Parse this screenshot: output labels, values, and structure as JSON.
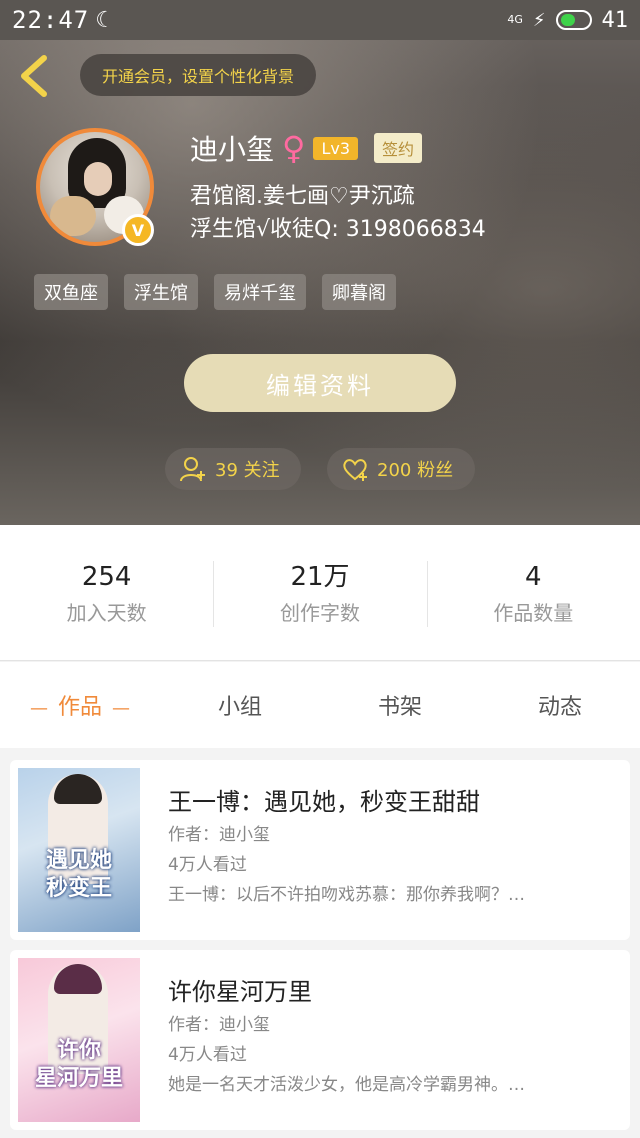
{
  "status_bar": {
    "time": "22:47",
    "network": "4G",
    "battery": "41"
  },
  "header": {
    "vip_banner": "开通会员，设置个性化背景",
    "username": "迪小玺",
    "gender_symbol": "♀",
    "level": "Lv3",
    "signed_badge": "签约",
    "bio_line1": "君馆阁.姜七画♡尹沉疏",
    "bio_line2": "浮生馆√收徒Q: 3198066834",
    "verified_symbol": "V",
    "tags": [
      "双鱼座",
      "浮生馆",
      "易烊千玺",
      "卿暮阁"
    ],
    "edit_button": "编辑资料",
    "following": "39 关注",
    "fans": "200 粉丝"
  },
  "stats": [
    {
      "value": "254",
      "label": "加入天数"
    },
    {
      "value": "21万",
      "label": "创作字数"
    },
    {
      "value": "4",
      "label": "作品数量"
    }
  ],
  "tabs": [
    "作品",
    "小组",
    "书架",
    "动态"
  ],
  "books": [
    {
      "title": "王一博：遇见她，秒变王甜甜",
      "author": "作者：迪小玺",
      "reads": "4万人看过",
      "description": "王一博：以后不许拍吻戏苏慕：那你养我啊？…",
      "cover_line1": "遇见她",
      "cover_line2": "秒变王"
    },
    {
      "title": "许你星河万里",
      "author": "作者：迪小玺",
      "reads": "4万人看过",
      "description": "她是一名天才活泼少女，他是高冷学霸男神。…",
      "cover_line1": "许你",
      "cover_line2": "星河万里"
    }
  ],
  "colors": {
    "accent": "#f08a3a",
    "gold": "#f3d34a",
    "edit_button_bg": "#e6dcb6"
  }
}
